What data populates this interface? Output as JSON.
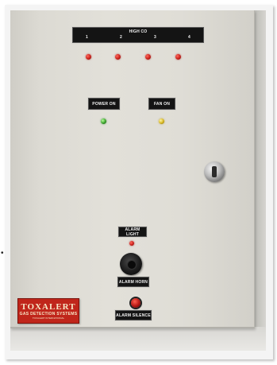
{
  "panel": {
    "high_co_title": "HIGH CO",
    "zone_numbers": [
      "1",
      "2",
      "3",
      "4"
    ],
    "power_on_label": "POWER ON",
    "fan_on_label": "FAN ON",
    "alarm_light_label": "ALARM LIGHT",
    "alarm_horn_label": "ALARM HORN",
    "alarm_silence_label": "ALARM SILENCE"
  },
  "brand": {
    "name": "TOXALERT",
    "tagline": "GAS DETECTION SYSTEMS",
    "fine_print": "TOXALERT INTERNATIONAL"
  },
  "colors": {
    "panel": "#e2e0d9",
    "plate": "#141414",
    "led_red": "#c9201a",
    "led_green": "#3aa12b",
    "led_yellow": "#d6b51f",
    "brand_red": "#c0261b"
  }
}
